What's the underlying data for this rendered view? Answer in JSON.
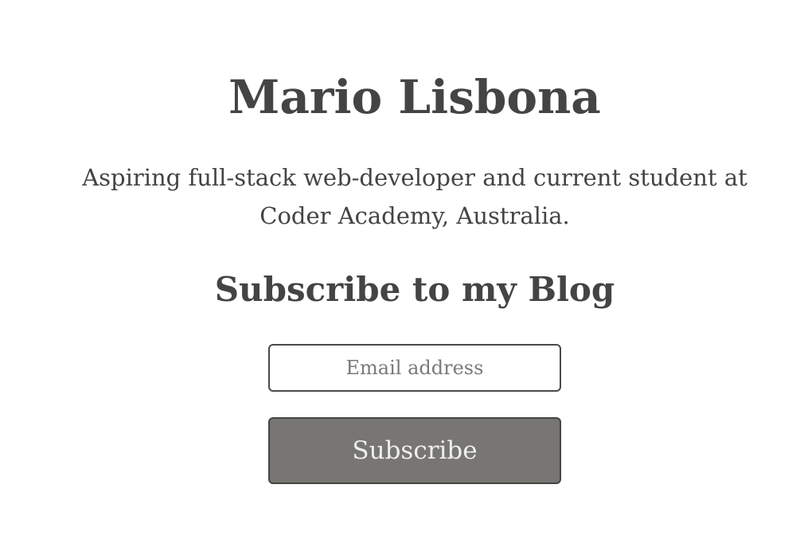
{
  "profile": {
    "name": "Mario Lisbona",
    "bio": "Aspiring full-stack web-developer and current student at Coder Academy, Australia."
  },
  "subscribe": {
    "heading": "Subscribe to my Blog",
    "email_placeholder": "Email address",
    "email_value": "",
    "button_label": "Subscribe"
  },
  "colors": {
    "text": "#444444",
    "button_bg": "#777672",
    "button_text": "#eeeeee",
    "input_border": "#4a4a4a",
    "background": "#ffffff"
  }
}
